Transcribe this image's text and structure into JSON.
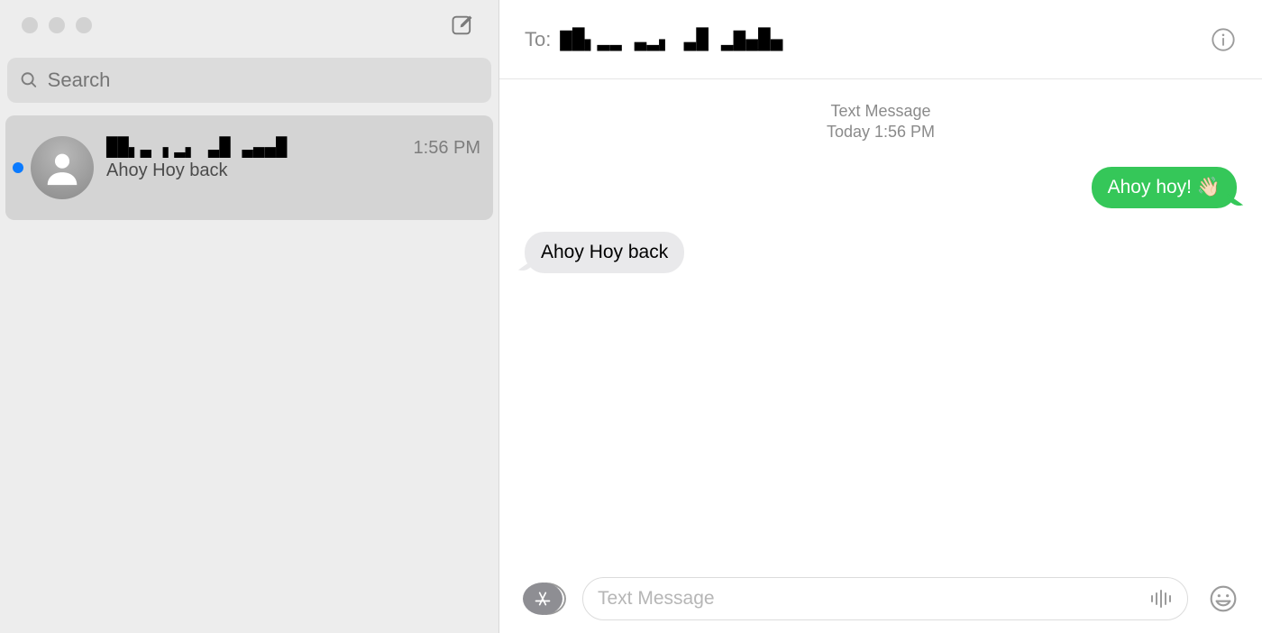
{
  "sidebar": {
    "search_placeholder": "Search",
    "conversations": [
      {
        "name": "██▖▃ ▖▂▖ ▃█ ▃▄▄█",
        "preview": "Ahoy Hoy back",
        "time": "1:56 PM",
        "unread": true
      }
    ]
  },
  "conversation": {
    "to_label": "To:",
    "to_value": "▇█▖▂▂ ▃▂▖ ▃█ ▂▇▄█▄",
    "meta_label": "Text Message",
    "meta_time": "Today 1:56 PM",
    "messages": {
      "outgoing_0": "Ahoy hoy! 👋🏻",
      "incoming_0": "Ahoy Hoy back"
    }
  },
  "composer": {
    "placeholder": "Text Message"
  },
  "colors": {
    "sms_green": "#35c759",
    "incoming_gray": "#e9e9eb",
    "sidebar_bg": "#ededed",
    "unread_blue": "#0a7aff"
  }
}
